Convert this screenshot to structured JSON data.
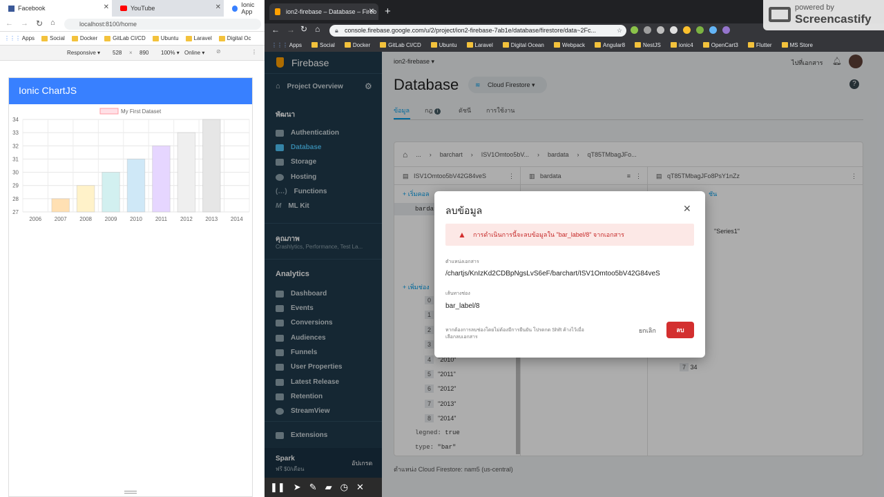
{
  "left_browser": {
    "tabs": [
      {
        "label": "Facebook"
      },
      {
        "label": "YouTube"
      },
      {
        "label": "Ionic App"
      }
    ],
    "url": "localhost:8100/home",
    "bookmarks": [
      "Apps",
      "Social",
      "Docker",
      "GitLab CI/CD",
      "Ubuntu",
      "Laravel",
      "Digital Oc"
    ],
    "device_bar": {
      "mode": "Responsive",
      "width": "528",
      "x": "×",
      "height": "890",
      "zoom": "100%",
      "network": "Online"
    },
    "app_title": "Ionic ChartJS",
    "chart_data": {
      "type": "bar",
      "title": "",
      "legend": [
        "My First Dataset"
      ],
      "categories": [
        "2006",
        "2007",
        "2008",
        "2009",
        "2010",
        "2011",
        "2012",
        "2013",
        "2014"
      ],
      "series": [
        {
          "name": "My First Dataset",
          "values": [
            null,
            28,
            29,
            30,
            31,
            32,
            33,
            34,
            null
          ]
        }
      ],
      "ylim": [
        27,
        34
      ],
      "yticks": [
        "27",
        "28",
        "29",
        "30",
        "31",
        "32",
        "33",
        "34"
      ],
      "colors": [
        "#ffe0b3",
        "#fff2c9",
        "#d2f0f0",
        "#cfe8f7",
        "#e6d6ff",
        "#efefef",
        "#e6e6e6"
      ],
      "grid": true
    }
  },
  "right_browser": {
    "tab_title": "ion2-firebase – Database – Fireb",
    "url": "console.firebase.google.com/u/2/project/ion2-firebase-7ab1e/database/firestore/data~2Fc...",
    "bookmarks": [
      "Apps",
      "Social",
      "Docker",
      "GitLab CI/CD",
      "Ubuntu",
      "Laravel",
      "Digital Ocean",
      "Webpack",
      "Angular8",
      "NestJS",
      "ionic4",
      "OpenCart3",
      "Flutter",
      "MS Store"
    ]
  },
  "watermark": {
    "line1": "powered by",
    "line2": "Screencastify"
  },
  "firebase": {
    "brand": "Firebase",
    "project": "ion2-firebase",
    "goto_docs": "ไปที่เอกสาร",
    "sidebar": {
      "overview": "Project Overview",
      "section_dev": "พัฒนา",
      "dev_items": [
        "Authentication",
        "Database",
        "Storage",
        "Hosting",
        "Functions",
        "ML Kit"
      ],
      "section_quality": "คุณภาพ",
      "quality_sub": "Crashlytics, Performance, Test La...",
      "section_analytics": "Analytics",
      "analytics_items": [
        "Dashboard",
        "Events",
        "Conversions",
        "Audiences",
        "Funnels",
        "User Properties",
        "Latest Release",
        "Retention",
        "StreamView"
      ],
      "extensions": "Extensions",
      "plan": "Spark",
      "plan_sub": "ฟรี $0/เดือน",
      "upgrade": "อัปเกรด"
    },
    "page_title": "Database",
    "db_selector": "Cloud Firestore",
    "tabs": [
      "ข้อมูล",
      "กฎ",
      "ดัชนี",
      "การใช้งาน"
    ],
    "breadcrumb": [
      "...",
      "barchart",
      "ISV1Omtoo5bV...",
      "bardata",
      "qT85TMbagJFo..."
    ],
    "col1_header": "ISV1Omtoo5bV42G84veS",
    "col2_header": "bardata",
    "col3_header": "qT85TMbagJFo8PsY1nZz",
    "start_collection": "เริ่มคอล",
    "add_field": "เพิ่มช่อง",
    "col1_item": "bardat",
    "array_items": [
      {
        "i": "0",
        "v": ""
      },
      {
        "i": "1",
        "v": ""
      },
      {
        "i": "2",
        "v": ""
      },
      {
        "i": "3",
        "v": ""
      },
      {
        "i": "4",
        "v": "\"2010\""
      },
      {
        "i": "5",
        "v": "\"2011\""
      },
      {
        "i": "6",
        "v": "\"2012\""
      },
      {
        "i": "7",
        "v": "\"2013\""
      },
      {
        "i": "8",
        "v": "\"2014\""
      }
    ],
    "fields": [
      {
        "k": "legned:",
        "v": "true"
      },
      {
        "k": "type:",
        "v": "\"bar\""
      }
    ],
    "col3_add": "ชัน",
    "col3_value": "\"Series1\"",
    "col3_row": {
      "i": "7",
      "v": "34"
    },
    "location": "ตำแหน่ง Cloud Firestore: nam5 (us-central)"
  },
  "dialog": {
    "title": "ลบข้อมูล",
    "warning": "การดำเนินการนี้จะลบข้อมูลใน \"bar_label/8\" จากเอกสาร",
    "loc_label": "ตำแหน่งเอกสาร",
    "loc_value": "/chartjs/KnIzKd2CDBpNgsLvS6eF/barchart/ISV1Omtoo5bV42G84veS",
    "path_label": "เส้นทางช่อง",
    "path_value": "bar_label/8",
    "hint": "หากต้องการลบช่องโดยไม่ต้องมีการยืนยัน โปรดกด Shift ค้างไว้เมื่อเลือกลบเอกสาร",
    "cancel": "ยกเลิก",
    "delete": "ลบ"
  }
}
